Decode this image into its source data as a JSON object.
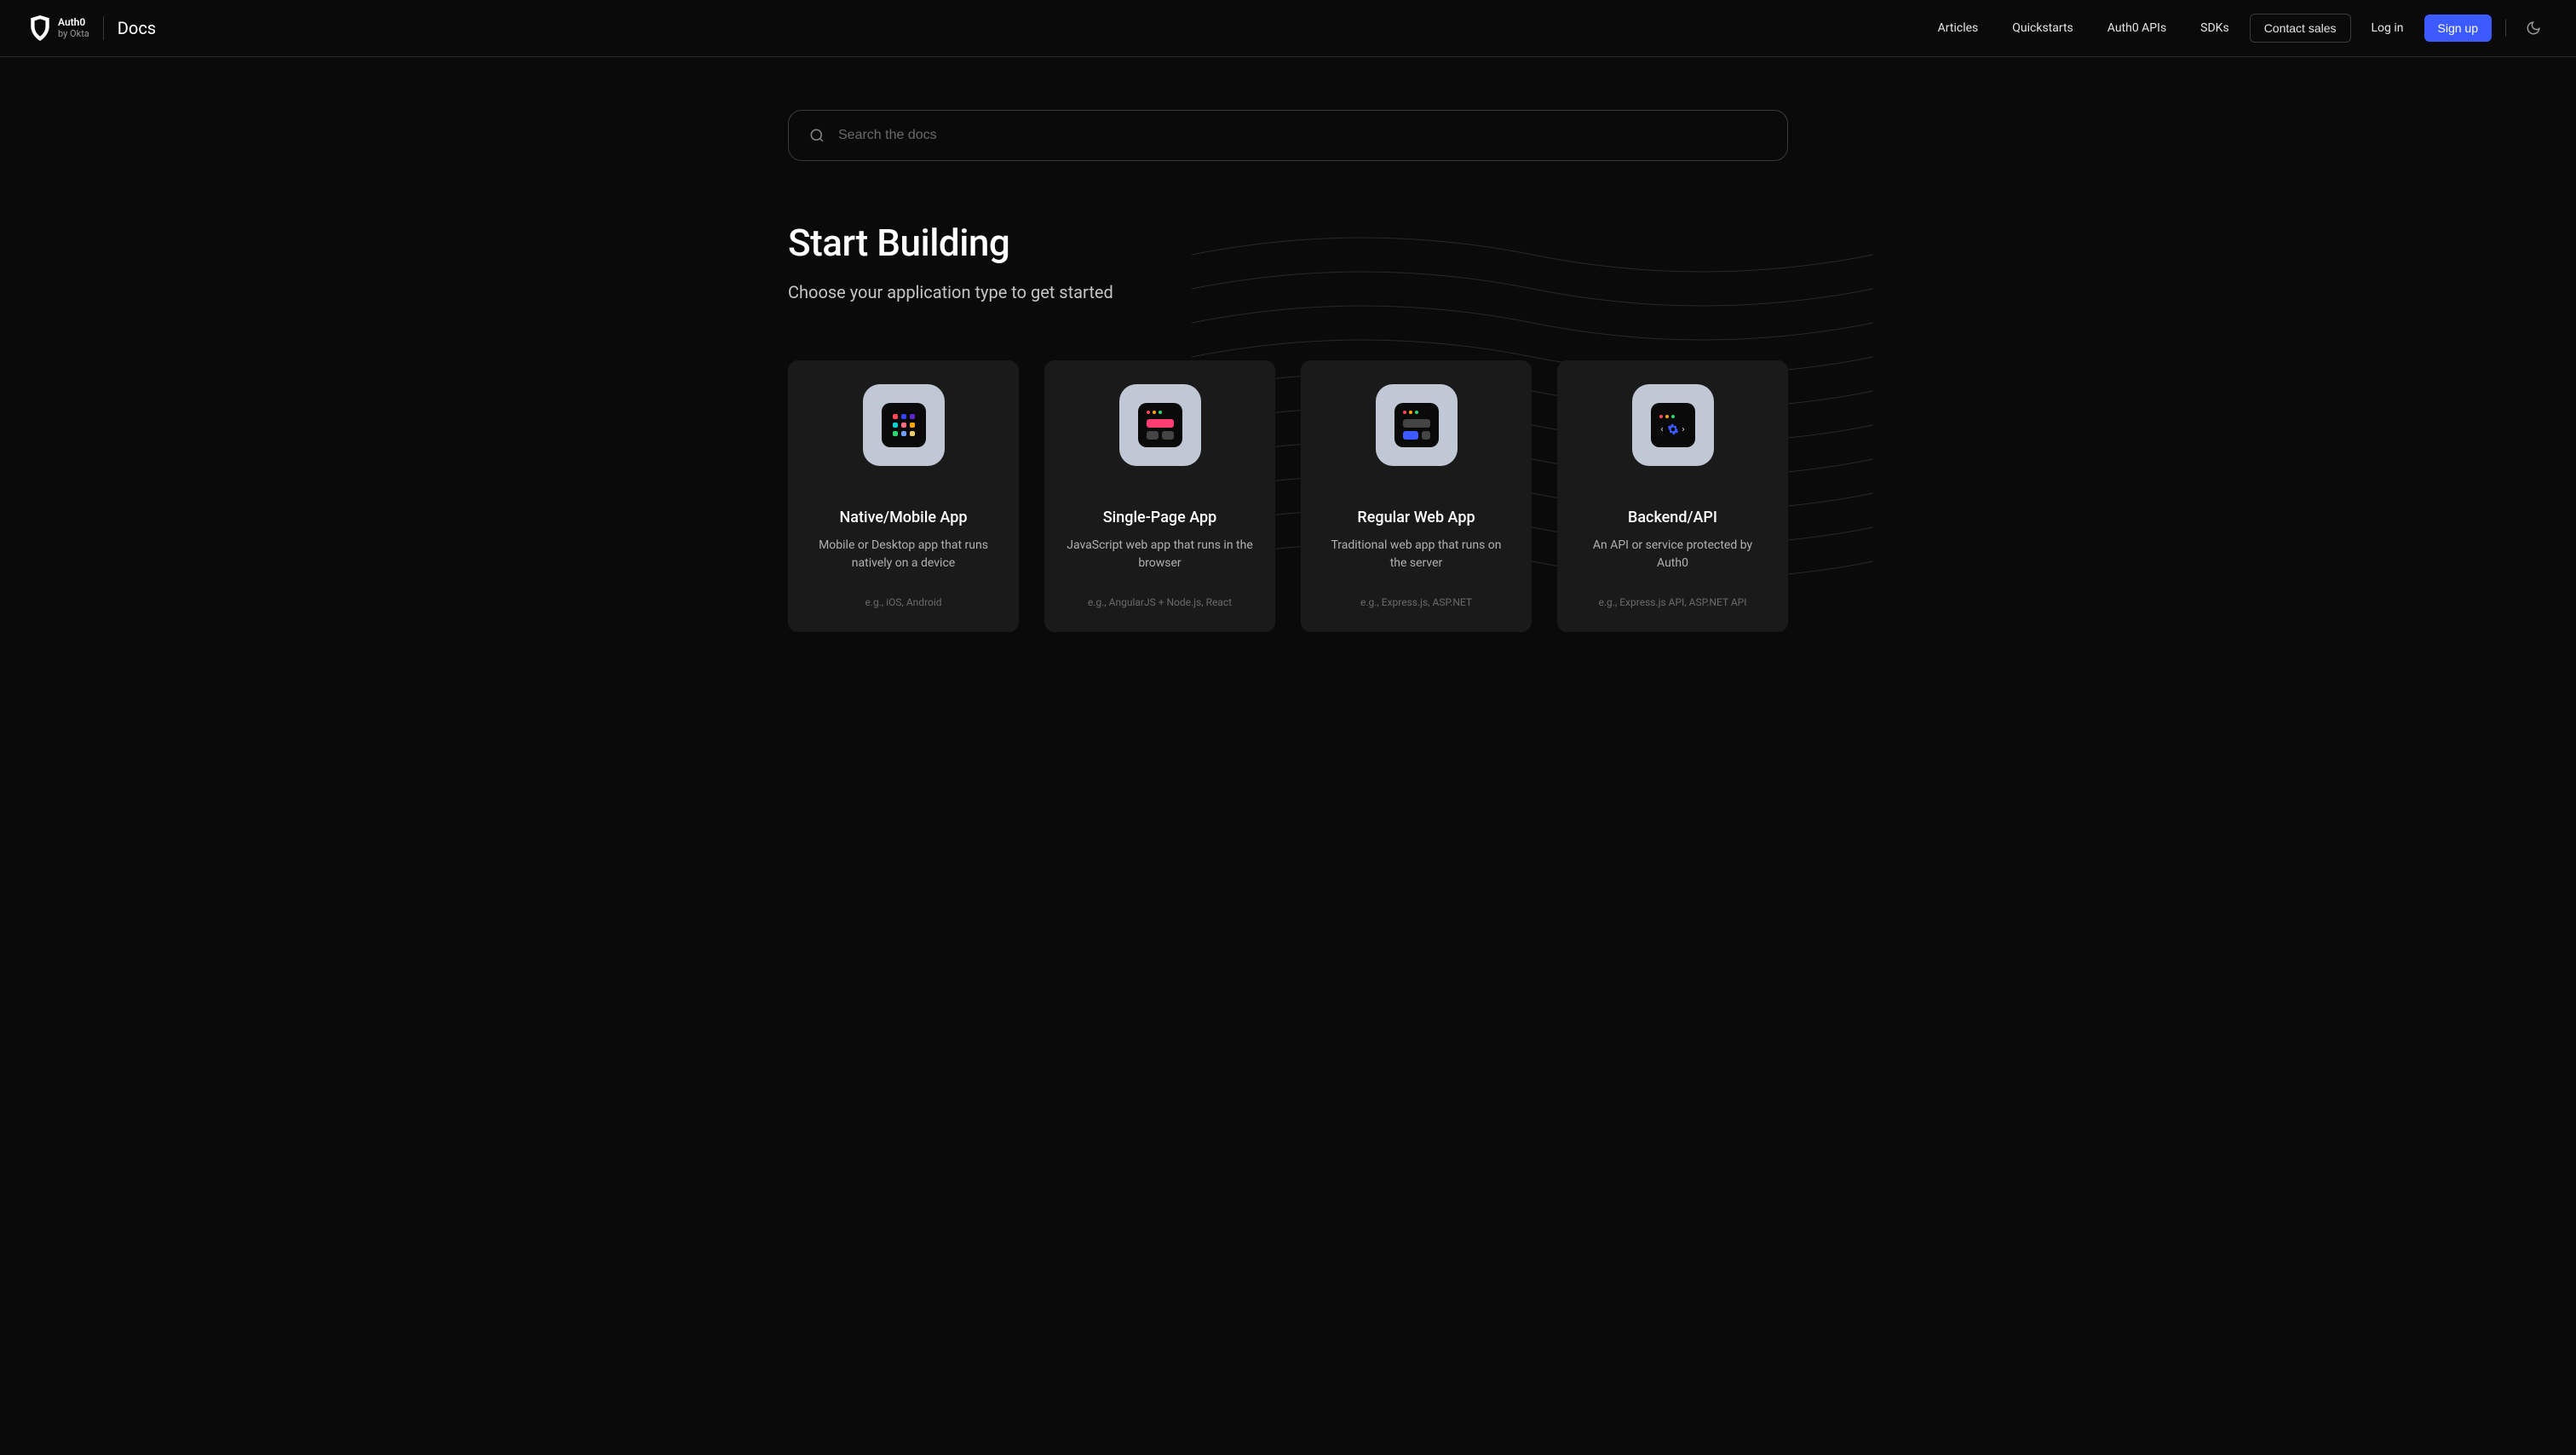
{
  "header": {
    "logo": {
      "name": "Auth0",
      "byline": "by Okta"
    },
    "docs_label": "Docs",
    "nav": [
      {
        "label": "Articles"
      },
      {
        "label": "Quickstarts"
      },
      {
        "label": "Auth0 APIs"
      },
      {
        "label": "SDKs"
      }
    ],
    "contact_label": "Contact sales",
    "login_label": "Log in",
    "signup_label": "Sign up"
  },
  "search": {
    "placeholder": "Search the docs"
  },
  "hero": {
    "title": "Start Building",
    "subtitle": "Choose your application type to get started"
  },
  "cards": [
    {
      "title": "Native/Mobile App",
      "desc": "Mobile or Desktop app that runs natively on a device",
      "eg": "e.g., iOS, Android"
    },
    {
      "title": "Single-Page App",
      "desc": "JavaScript web app that runs in the browser",
      "eg": "e.g., AngularJS + Node.js, React"
    },
    {
      "title": "Regular Web App",
      "desc": "Traditional web app that runs on the server",
      "eg": "e.g., Express.js, ASP.NET"
    },
    {
      "title": "Backend/API",
      "desc": "An API or service protected by Auth0",
      "eg": "e.g., Express.js API, ASP.NET API"
    }
  ]
}
